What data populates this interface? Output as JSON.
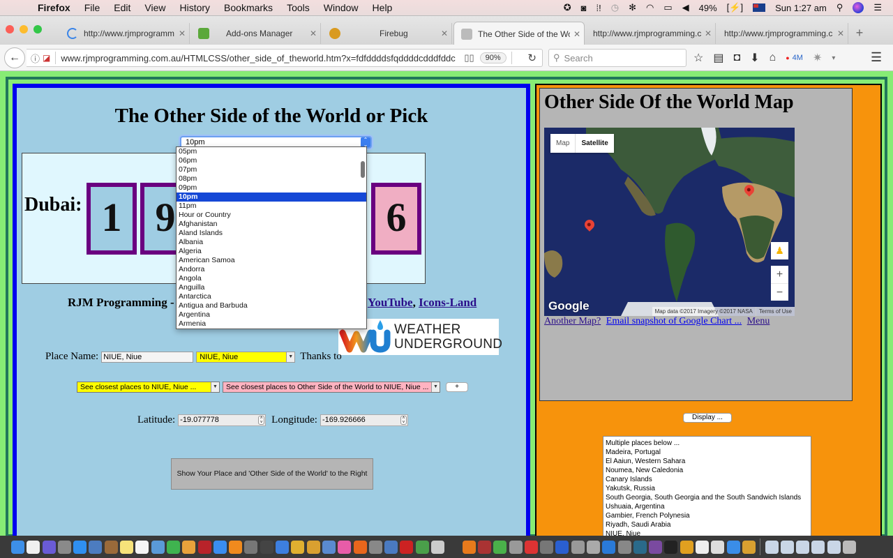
{
  "menubar": {
    "app": "Firefox",
    "items": [
      "File",
      "Edit",
      "View",
      "History",
      "Bookmarks",
      "Tools",
      "Window",
      "Help"
    ],
    "battery": "49%",
    "clock": "Sun 1:27 am"
  },
  "tabs": [
    {
      "label": "http://www.rjmprogramm",
      "icon": "loading-icon",
      "active": false
    },
    {
      "label": "Add-ons Manager",
      "icon": "puzzle-icon",
      "active": false
    },
    {
      "label": "Firebug",
      "icon": "firebug-icon",
      "active": false
    },
    {
      "label": "The Other Side of the Wo",
      "icon": "globe-icon",
      "active": true
    },
    {
      "label": "http://www.rjmprogramming.c",
      "icon": "",
      "active": false
    },
    {
      "label": "http://www.rjmprogramming.c",
      "icon": "",
      "active": false
    }
  ],
  "navbar": {
    "url": "www.rjmprogramming.com.au/HTMLCSS/other_side_of_theworld.htm?x=fdfddddsfqddddcdddfddc",
    "zoom": "90%",
    "search_placeholder": "Search",
    "download_badge": "4M"
  },
  "left": {
    "title": "The Other Side of the World or Pick",
    "hour_select": {
      "value": "10pm",
      "options": [
        "05pm",
        "06pm",
        "07pm",
        "08pm",
        "09pm",
        "10pm",
        "11pm",
        "Hour or Country",
        "Afghanistan",
        "Aland Islands",
        "Albania",
        "Algeria",
        "American Samoa",
        "Andorra",
        "Angola",
        "Anguilla",
        "Antarctica",
        "Antigua and Barbuda",
        "Argentina",
        "Armenia"
      ],
      "selected_index": 5
    },
    "clock": {
      "label": "Dubai:",
      "digits": [
        "1",
        "9",
        "6"
      ]
    },
    "credit": {
      "prefix": "RJM Programming -",
      "links": [
        "YouTube",
        "Icons-Land"
      ],
      "separator": ","
    },
    "place": {
      "label": "Place Name:",
      "input_value": "NIUE, Niue",
      "select_value": "NIUE, Niue",
      "thanks": "Thanks to",
      "logo_line1": "WEATHER",
      "logo_line2": "UNDERGROUND"
    },
    "closest": {
      "select1": "See closest places to NIUE, Niue ...",
      "select2": "See closest places to Other Side of the World to NIUE, Niue ...",
      "plus": "+"
    },
    "coords": {
      "lat_label": "Latitude:",
      "lat_value": "-19.077778",
      "lon_label": "Longitude:",
      "lon_value": "-169.926666"
    },
    "show_button": "Show Your Place and 'Other Side of the World' to the Right"
  },
  "right": {
    "title": "Other Side Of the World Map",
    "map": {
      "type_map": "Map",
      "type_satellite": "Satellite",
      "zoom_in": "+",
      "zoom_out": "−",
      "logo": "Google",
      "attribution": "Map data ©2017 Imagery ©2017 NASA",
      "terms": "Terms of Use"
    },
    "links": [
      "Another Map?",
      "Email snapshot of Google Chart ...",
      "Menu"
    ],
    "display_button": "Display ...",
    "places": [
      "Multiple places below ...",
      "Madeira, Portugal",
      "El Aaiun, Western Sahara",
      "Noumea, New Caledonia",
      "Canary Islands",
      "Yakutsk, Russia",
      "South Georgia, South Georgia and the South Sandwich Islands",
      "Ushuaia, Argentina",
      "Gambier, French Polynesia",
      "Riyadh, Saudi Arabia",
      "NIUE, Niue"
    ]
  },
  "colors": {
    "page_bg": "#87ec75",
    "left_border": "#0000ee",
    "left_bg": "#9fcde3",
    "right_bg": "#f7930c",
    "digit_border": "#6a0080",
    "selected_option": "#1548d6"
  }
}
